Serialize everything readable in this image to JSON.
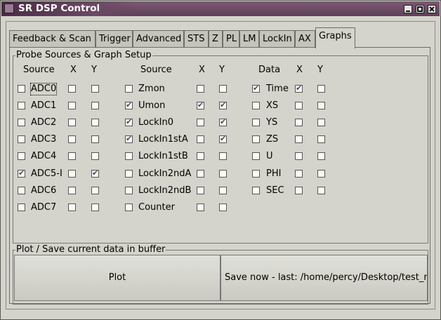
{
  "window": {
    "title": "SR DSP Control"
  },
  "tabs": [
    "Feedback & Scan",
    "Trigger",
    "Advanced",
    "STS",
    "Z",
    "PL",
    "LM",
    "LockIn",
    "AX",
    "Graphs"
  ],
  "active_tab": "Graphs",
  "probe_group": {
    "title": "Probe Sources & Graph Setup",
    "headers": {
      "col1": [
        "Source",
        "X",
        "Y"
      ],
      "col2": [
        "Source",
        "X",
        "Y"
      ],
      "col3": [
        "Data",
        "X",
        "Y"
      ]
    },
    "col1": [
      {
        "label": "ADC0",
        "sel": false,
        "x": false,
        "y": false
      },
      {
        "label": "ADC1",
        "sel": false,
        "x": false,
        "y": false
      },
      {
        "label": "ADC2",
        "sel": false,
        "x": false,
        "y": false
      },
      {
        "label": "ADC3",
        "sel": false,
        "x": false,
        "y": false
      },
      {
        "label": "ADC4",
        "sel": false,
        "x": false,
        "y": false
      },
      {
        "label": "ADC5-I",
        "sel": true,
        "x": false,
        "y": true
      },
      {
        "label": "ADC6",
        "sel": false,
        "x": false,
        "y": false
      },
      {
        "label": "ADC7",
        "sel": false,
        "x": false,
        "y": false
      }
    ],
    "col2": [
      {
        "label": "Zmon",
        "sel": false,
        "x": false,
        "y": false
      },
      {
        "label": "Umon",
        "sel": true,
        "x": true,
        "y": true
      },
      {
        "label": "LockIn0",
        "sel": true,
        "x": false,
        "y": true
      },
      {
        "label": "LockIn1stA",
        "sel": true,
        "x": false,
        "y": true
      },
      {
        "label": "LockIn1stB",
        "sel": false,
        "x": false,
        "y": false
      },
      {
        "label": "LockIn2ndA",
        "sel": false,
        "x": false,
        "y": false
      },
      {
        "label": "LockIn2ndB",
        "sel": false,
        "x": false,
        "y": false
      },
      {
        "label": "Counter",
        "sel": false,
        "x": false,
        "y": false
      }
    ],
    "col3": [
      {
        "label": "Time",
        "sel": true,
        "x": true,
        "y": false
      },
      {
        "label": "XS",
        "sel": false,
        "x": false,
        "y": false
      },
      {
        "label": "YS",
        "sel": false,
        "x": false,
        "y": false
      },
      {
        "label": "ZS",
        "sel": false,
        "x": false,
        "y": false
      },
      {
        "label": "U",
        "sel": false,
        "x": false,
        "y": false
      },
      {
        "label": "PHI",
        "sel": false,
        "x": false,
        "y": false
      },
      {
        "label": "SEC",
        "sel": false,
        "x": false,
        "y": false
      }
    ]
  },
  "plot_group": {
    "title": "Plot / Save current data in buffer",
    "plot_label": "Plot",
    "save_label": "Save now - last: /home/percy/Desktop/test_n"
  }
}
